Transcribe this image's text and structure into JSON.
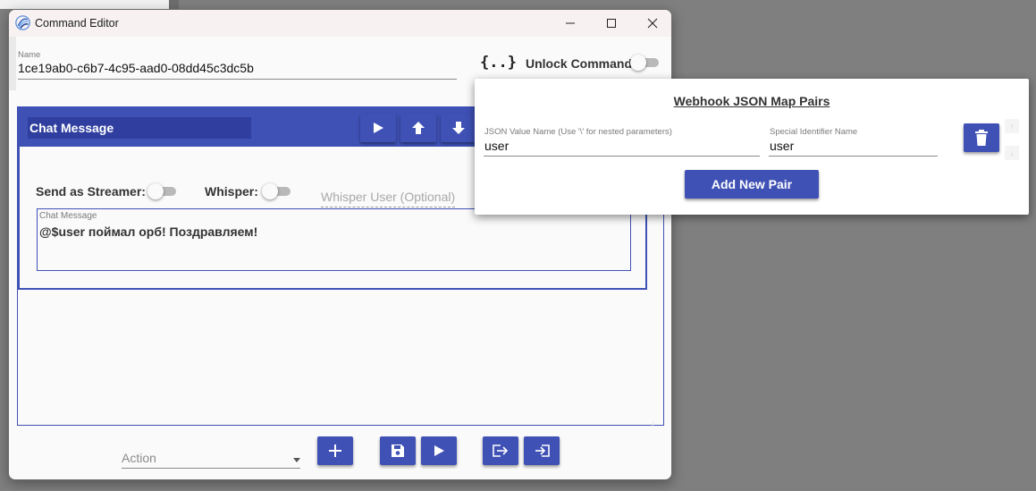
{
  "window": {
    "title": "Command Editor",
    "controls": {
      "minimize": "—",
      "maximize": "☐",
      "close": "✕"
    }
  },
  "name_field": {
    "label": "Name",
    "value": "1ce19ab0-c6b7-4c95-aad0-08dd45c3dc5b"
  },
  "json_button": {
    "text": "{..}"
  },
  "unlock": {
    "label": "Unlock Command:",
    "enabled": false
  },
  "action_card": {
    "header_name": "Chat Message",
    "send_as_streamer_label": "Send as Streamer:",
    "send_as_streamer": false,
    "whisper_label": "Whisper:",
    "whisper": false,
    "whisper_user_placeholder": "Whisper User (Optional)",
    "chat_message_label": "Chat Message",
    "chat_message_value": "@$user поймал орб! Поздравляем!"
  },
  "footer": {
    "action_placeholder": "Action"
  },
  "webhook_popup": {
    "title": "Webhook JSON Map Pairs",
    "pairs": [
      {
        "json_label": "JSON Value Name (Use '\\' for nested parameters)",
        "json_value": "user",
        "special_label": "Special Identifier Name",
        "special_value": "user"
      }
    ],
    "add_button": "Add New Pair"
  },
  "colors": {
    "accent": "#3f51b5",
    "accent_dark": "#303f9f",
    "background": "#7f7f7f"
  }
}
